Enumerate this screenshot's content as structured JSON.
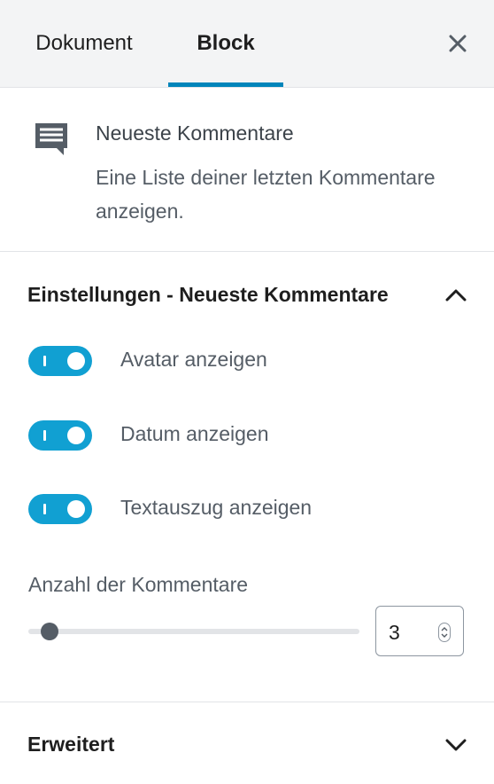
{
  "tabs": [
    {
      "label": "Dokument",
      "active": false
    },
    {
      "label": "Block",
      "active": true
    }
  ],
  "block_card": {
    "icon": "comments-icon",
    "title": "Neueste Kommentare",
    "description": "Eine Liste deiner letzten Kommentare anzeigen."
  },
  "settings": {
    "title": "Einstellungen - Neueste Kommentare",
    "expanded": true,
    "toggles": [
      {
        "label": "Avatar anzeigen",
        "checked": true
      },
      {
        "label": "Datum anzeigen",
        "checked": true
      },
      {
        "label": "Textauszug anzeigen",
        "checked": true
      }
    ],
    "count_label": "Anzahl der Kommentare",
    "count_value": "3"
  },
  "advanced": {
    "title": "Erweitert",
    "expanded": false
  },
  "colors": {
    "accent": "#0085ba",
    "toggle_on": "#11a0d2"
  }
}
